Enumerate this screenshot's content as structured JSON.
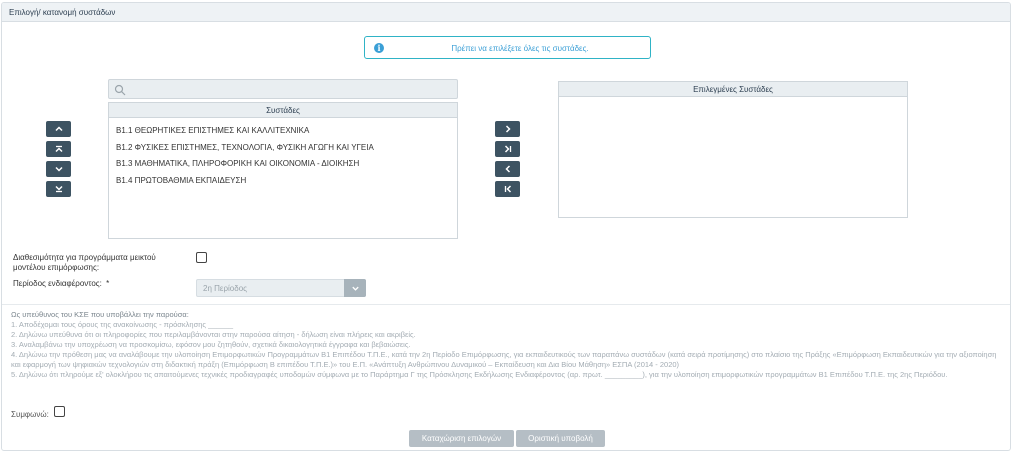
{
  "panel": {
    "title": "Επιλογή/ κατανομή συστάδων"
  },
  "info": {
    "icon": "info-icon",
    "message": "Πρέπει να επιλέξετε όλες τις συστάδες."
  },
  "search": {
    "placeholder": "",
    "value": ""
  },
  "available": {
    "header": "Συστάδες",
    "items": [
      "Β1.1 ΘΕΩΡΗΤΙΚΕΣ ΕΠΙΣΤΗΜΕΣ ΚΑΙ ΚΑΛΛΙΤΕΧΝΙΚΑ",
      "Β1.2 ΦΥΣΙΚΕΣ ΕΠΙΣΤΗΜΕΣ, ΤΕΧΝΟΛΟΓΙΑ, ΦΥΣΙΚΗ ΑΓΩΓΗ ΚΑΙ ΥΓΕΙΑ",
      "Β1.3 ΜΑΘΗΜΑΤΙΚΑ, ΠΛΗΡΟΦΟΡΙΚΗ ΚΑΙ ΟΙΚΟΝΟΜΙΑ - ΔΙΟΙΚΗΣΗ",
      "Β1.4 ΠΡΩΤΟΒΑΘΜΙΑ ΕΚΠΑΙΔΕΥΣΗ"
    ]
  },
  "selected": {
    "header": "Επιλεγμένες Συστάδες",
    "items": []
  },
  "order_buttons": [
    "move-up-icon",
    "move-top-icon",
    "move-down-icon",
    "move-bottom-icon"
  ],
  "transfer_buttons": [
    "move-right-icon",
    "move-all-right-icon",
    "move-left-icon",
    "move-all-left-icon"
  ],
  "form": {
    "mixed_label": "Διαθεσιμότητα για προγράμματα μεικτού μοντέλου επιμόρφωσης:",
    "mixed_checked": false,
    "period_label": "Περίοδος ενδιαφέροντος:",
    "period_required": "*",
    "period_value": "2η Περίοδος"
  },
  "declaration": {
    "title": "Ως υπεύθυνος του ΚΣΕ που υποβάλλει την παρούσα:",
    "lines": [
      "1. Αποδέχομαι τους όρους της ανακοίνωσης - πρόσκλησης ______",
      "2. Δηλώνω υπεύθυνα ότι οι πληροφορίες που περιλαμβάνονται στην παρούσα αίτηση - δήλωση είναι πλήρεις και ακριβείς.",
      "3. Αναλαμβάνω την υποχρέωση να προσκομίσω, εφόσον μου ζητηθούν, σχετικά δικαιολογητικά έγγραφα και βεβαιώσεις.",
      "4. Δηλώνω την πρόθεση μας να αναλάβουμε την υλοποίηση Επιμορφωτικών Προγραμμάτων Β1 Επιπέδου Τ.Π.Ε., κατά την 2η Περίοδο Επιμόρφωσης, για εκπαιδευτικούς των παραπάνω συστάδων (κατά σειρά προτίμησης) στο πλαίσιο της Πράξης «Επιμόρφωση Εκπαιδευτικών για την αξιοποίηση και εφαρμογή των ψηφιακών τεχνολογιών στη διδακτική πράξη (Επιμόρφωση Β επιπέδου Τ.Π.Ε.)» του Ε.Π. «Ανάπτυξη Ανθρώπινου Δυναμικού – Εκπαίδευση και Δια Βίου Μάθηση» ΕΣΠΑ (2014 - 2020)",
      "5. Δηλώνω ότι πληρούμε εξ' ολοκλήρου τις απαιτούμενες τεχνικές προδιαγραφές υποδομών σύμφωνα με το Παράρτημα Γ της Πρόσκλησης Εκδήλωσης Ενδιαφέροντος (αρ. πρωτ. _________), για την υλοποίηση επιμορφωτικών προγραμμάτων Β1 Επιπέδου Τ.Π.Ε. της 2ης Περιόδου."
    ],
    "agree_label": "Συμφωνώ:",
    "agree_checked": false
  },
  "actions": {
    "save_label": "Καταχώριση επιλογών",
    "submit_label": "Οριστική υποβολή"
  },
  "colors": {
    "accent": "#3d5362",
    "info": "#3a9fd6",
    "info_border": "#2fb3c6",
    "disabled": "#b5bec5"
  }
}
